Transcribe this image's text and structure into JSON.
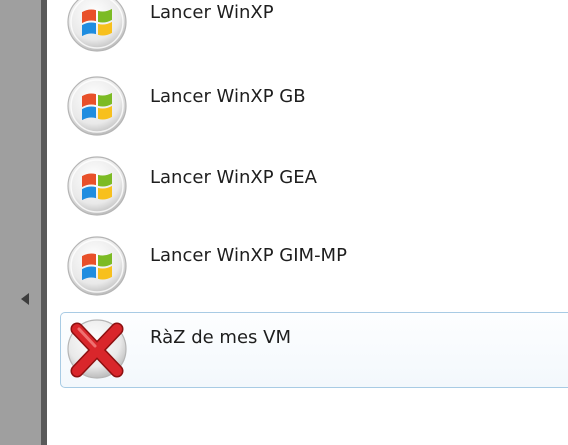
{
  "sidebar": {
    "collapse_icon": "triangle-left-icon"
  },
  "menu": {
    "items": [
      {
        "label": "Lancer WinXP",
        "icon": "windows-logo-icon"
      },
      {
        "label": "Lancer WinXP GB",
        "icon": "windows-logo-icon"
      },
      {
        "label": "Lancer WinXP GEA",
        "icon": "windows-logo-icon"
      },
      {
        "label": "Lancer WinXP GIM-MP",
        "icon": "windows-logo-icon"
      },
      {
        "label": "RàZ de mes VM",
        "icon": "red-x-icon"
      }
    ]
  },
  "colors": {
    "hover_border": "#a8cbe4",
    "sidebar": "#9f9f9f",
    "sidebar_edge": "#5a5a5a"
  }
}
